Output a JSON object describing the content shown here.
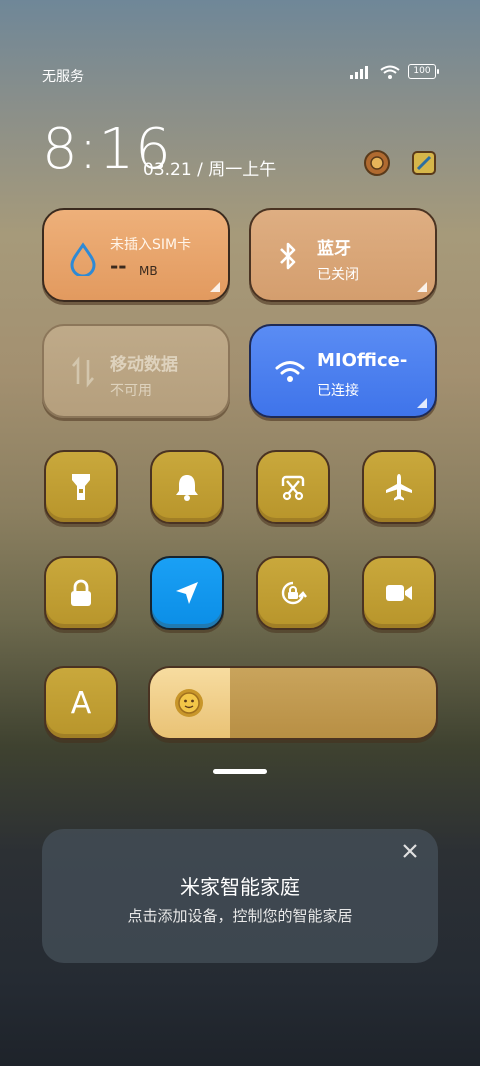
{
  "status_bar": {
    "carrier": "无服务",
    "battery": "100",
    "icons": [
      "signal-icon",
      "wifi-icon",
      "battery-icon"
    ]
  },
  "clock": {
    "time": "8:16",
    "date": "03.21 / 周一上午"
  },
  "top_icons": [
    "sun-cog-icon",
    "notes-icon"
  ],
  "tiles": {
    "sim": {
      "title": "未插入SIM卡",
      "value": "--",
      "unit": "MB",
      "icon": "water-drop-icon",
      "color": "#e9a46a"
    },
    "bluetooth": {
      "title": "蓝牙",
      "status": "已关闭",
      "icon": "bluetooth-icon",
      "color": "#d9a679"
    },
    "mobile_data": {
      "title": "移动数据",
      "status": "不可用",
      "icon": "data-arrows-icon",
      "color": "#b7a282"
    },
    "wifi": {
      "title": "MIOffice-",
      "status": "已连接",
      "icon": "wifi-icon",
      "color": "#4a7ff0"
    }
  },
  "toggles_row1": [
    {
      "name": "flashlight",
      "icon": "flashlight-icon"
    },
    {
      "name": "bell",
      "icon": "bell-icon"
    },
    {
      "name": "screenshot",
      "icon": "scissors-icon"
    },
    {
      "name": "airplane",
      "icon": "airplane-icon"
    }
  ],
  "toggles_row2": [
    {
      "name": "lock",
      "icon": "lock-icon"
    },
    {
      "name": "location",
      "icon": "location-arrow-icon",
      "active": true
    },
    {
      "name": "rotation-lock",
      "icon": "rotation-lock-icon"
    },
    {
      "name": "video",
      "icon": "video-camera-icon"
    }
  ],
  "auto_brightness": {
    "label": "A"
  },
  "brightness": {
    "level": 0.28,
    "icon": "sun-face-icon"
  },
  "mi_home_card": {
    "title": "米家智能家庭",
    "subtitle": "点击添加设备，控制您的智能家居"
  }
}
